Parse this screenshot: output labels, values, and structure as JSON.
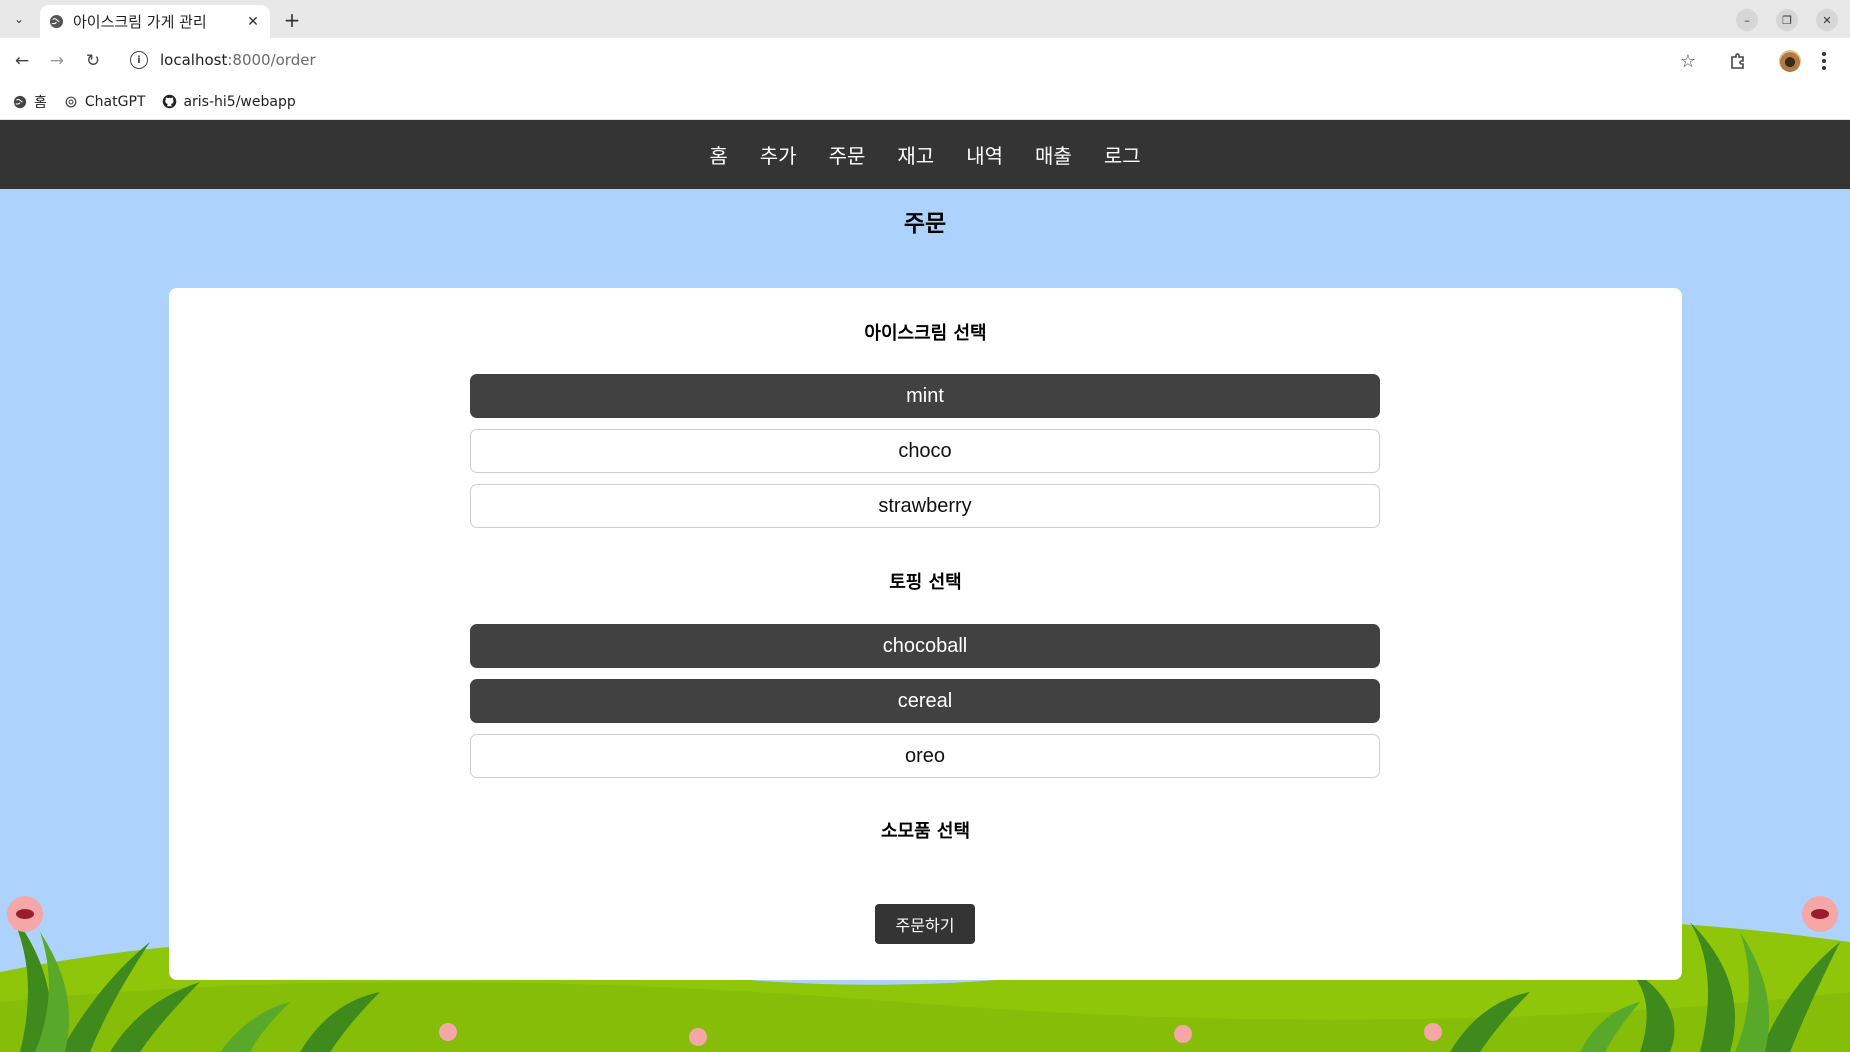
{
  "browser": {
    "tab_title": "아이스크림 가게 관리",
    "url_host": "localhost",
    "url_path": ":8000/order",
    "bookmarks": [
      {
        "label": "홈",
        "icon": "globe-icon"
      },
      {
        "label": "ChatGPT",
        "icon": "openai-icon"
      },
      {
        "label": "aris-hi5/webapp",
        "icon": "github-icon"
      }
    ]
  },
  "nav": {
    "items": [
      "홈",
      "추가",
      "주문",
      "재고",
      "내역",
      "매출",
      "로그"
    ]
  },
  "page": {
    "title": "주문"
  },
  "icecream": {
    "title": "아이스크림 선택",
    "options": [
      {
        "label": "mint",
        "selected": true
      },
      {
        "label": "choco",
        "selected": false
      },
      {
        "label": "strawberry",
        "selected": false
      }
    ]
  },
  "topping": {
    "title": "토핑 선택",
    "options": [
      {
        "label": "chocoball",
        "selected": true
      },
      {
        "label": "cereal",
        "selected": true
      },
      {
        "label": "oreo",
        "selected": false
      }
    ]
  },
  "consumable": {
    "title": "소모품 선택"
  },
  "order_button": "주문하기",
  "colors": {
    "nav_bg": "#343434",
    "page_bg": "#add3fd",
    "selected_option": "#414141",
    "grass": "#8fc60a"
  }
}
